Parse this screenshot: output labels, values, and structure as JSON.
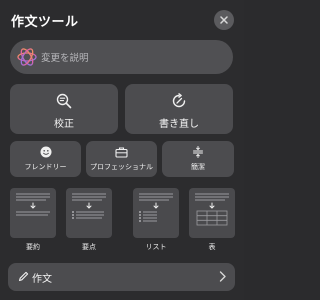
{
  "header": {
    "title": "作文ツール"
  },
  "describe": {
    "placeholder": "変更を説明"
  },
  "actions": {
    "proofread": "校正",
    "rewrite": "書き直し"
  },
  "tones": {
    "friendly": "フレンドリー",
    "professional": "プロフェッショナル",
    "concise": "簡潔"
  },
  "formats": {
    "summary": "要約",
    "key_points": "要点",
    "list": "リスト",
    "table": "表"
  },
  "compose": {
    "label": "作文"
  }
}
